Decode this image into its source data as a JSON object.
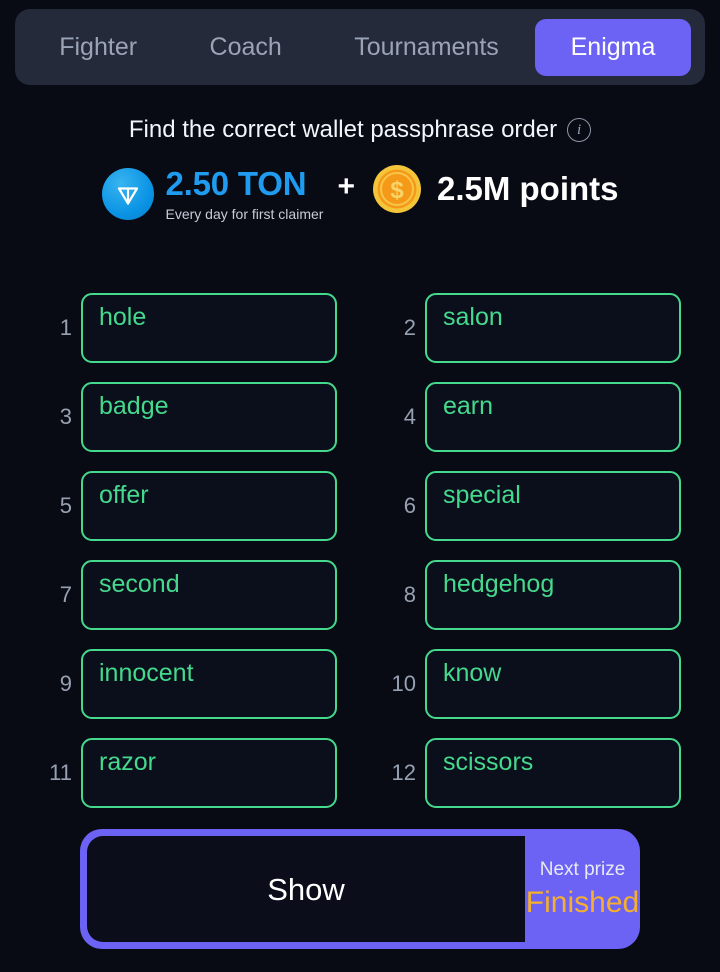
{
  "tabs": [
    {
      "label": "Fighter",
      "active": false
    },
    {
      "label": "Coach",
      "active": false
    },
    {
      "label": "Tournaments",
      "active": false
    },
    {
      "label": "Enigma",
      "active": true
    }
  ],
  "header": {
    "title": "Find the correct wallet passphrase order",
    "info_icon": "info-icon",
    "info_glyph": "i"
  },
  "prize": {
    "ton_icon": "ton-coin-icon",
    "ton_amount": "2.50 TON",
    "ton_subtitle": "Every day for first claimer",
    "separator": "+",
    "points_icon": "dollar-coin-icon",
    "points_amount": "2.5M points",
    "ton_color": "#1f9cf0",
    "points_color": "#ffffff"
  },
  "grid": {
    "word_color": "#45d98d",
    "border_color": "#45d98d",
    "cells": [
      {
        "index": "1",
        "word": "hole"
      },
      {
        "index": "2",
        "word": "salon"
      },
      {
        "index": "3",
        "word": "badge"
      },
      {
        "index": "4",
        "word": "earn"
      },
      {
        "index": "5",
        "word": "offer"
      },
      {
        "index": "6",
        "word": "special"
      },
      {
        "index": "7",
        "word": "second"
      },
      {
        "index": "8",
        "word": "hedgehog"
      },
      {
        "index": "9",
        "word": "innocent"
      },
      {
        "index": "10",
        "word": "know"
      },
      {
        "index": "11",
        "word": "razor"
      },
      {
        "index": "12",
        "word": "scissors"
      }
    ]
  },
  "bottom": {
    "show_label": "Show",
    "next_prize_label": "Next prize",
    "next_prize_value": "Finished",
    "accent_color": "#6c63f5",
    "next_prize_value_color": "#f5ae2e"
  }
}
